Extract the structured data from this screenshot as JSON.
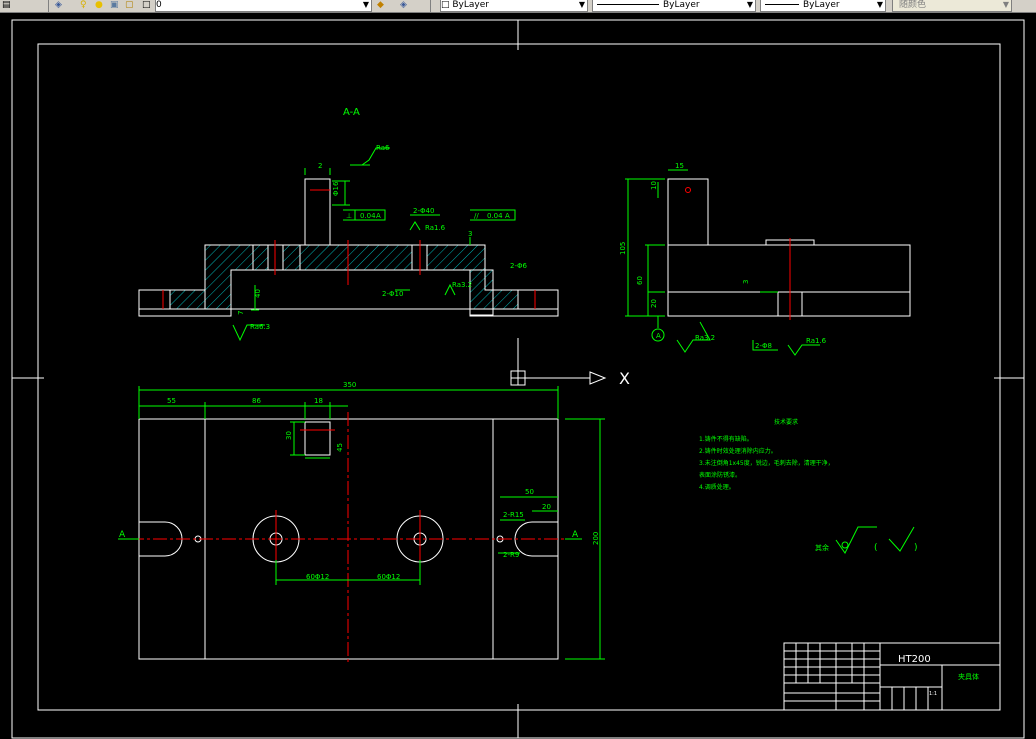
{
  "toolbar": {
    "layer_name": "0",
    "color_combo": "ByLayer",
    "linetype_combo": "ByLayer",
    "lineweight_combo": "ByLayer",
    "plotstyle_combo": "随颜色"
  },
  "drawing": {
    "section_label": "A-A",
    "dims": {
      "d350": "350",
      "d55": "55",
      "d86": "86",
      "d18": "18",
      "d30": "30",
      "d45": "45",
      "d50": "50",
      "d20": "20",
      "d200": "200",
      "d15": "15",
      "d10": "10",
      "d105": "105",
      "d60": "60",
      "d20b": "20",
      "d40": "40",
      "d2": "2",
      "d3": "3",
      "d3b": "3",
      "r15": "2-R15",
      "r9": "2-R9",
      "phi40": "2-Φ40",
      "phi16": "Φ16",
      "phi10": "2-Φ10",
      "phi6": "2-Φ6",
      "phi8": "2-Φ8",
      "phi60a": "60Φ12",
      "phi60b": "60Φ12",
      "phi40b": "Φ40"
    },
    "roughness": {
      "r1": "Ra6",
      "r2": "Ra1.6",
      "r3": "Ra3.2",
      "r4": "Ra6.3",
      "r5": "Ra3.2",
      "r6": "Ra1.6"
    },
    "tolerance": {
      "t1_sym": "⊥",
      "t1_val": "0.04",
      "t1_ref": "A",
      "t2_sym": "//",
      "t2_val": "0.04",
      "t2_ref": "A"
    },
    "datum": "A",
    "section_mark_left": "A",
    "section_mark_right": "A",
    "ucs_x": "X",
    "tech_req": {
      "title": "技术要求",
      "l1": "1.铸件不得有缺陷。",
      "l2": "2.铸件时效处理消除内应力。",
      "l3": "3.未注倒角1x45度，锐边，毛刺去除，清理干净，",
      "l4": "表面涂防锈漆。",
      "l5": "4.调质处理。"
    },
    "surface_note": "其余",
    "title_block": {
      "material": "HT200",
      "name": "夹具体",
      "scale": "1:1"
    }
  }
}
